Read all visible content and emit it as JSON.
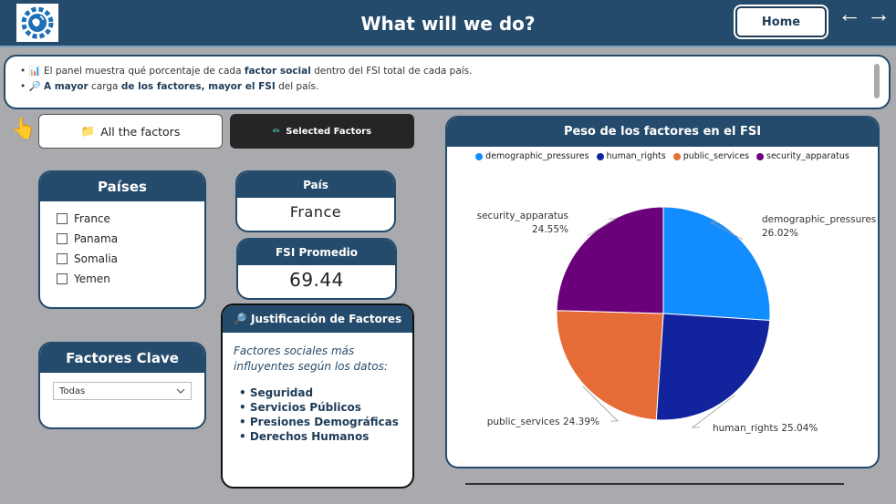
{
  "header": {
    "title": "What will we do?",
    "home_label": "Home",
    "back_arrow": "←",
    "forward_arrow": "→",
    "logo_icon": "gear-globe-icon"
  },
  "info": {
    "line1_prefix": "• 📊 El panel muestra qué porcentaje de cada ",
    "line1_bold": "factor social",
    "line1_suffix": " dentro del FSI total de cada país.",
    "line2_prefix": "• 🔎 ",
    "line2_bold1": "A mayor",
    "line2_mid1": " carga ",
    "line2_bold2": "de los factores, mayor el FSI",
    "line2_suffix": " del país."
  },
  "tabs": {
    "all_label": "All the factors",
    "all_icon": "📁",
    "selected_label": "Selected Factors",
    "selected_icon": "✏"
  },
  "paises": {
    "title": "Países",
    "items": [
      "France",
      "Panama",
      "Somalia",
      "Yemen"
    ]
  },
  "factores": {
    "title": "Factores Clave",
    "selected": "Todas"
  },
  "pais_card": {
    "title": "País",
    "value": "France"
  },
  "fsi_card": {
    "title": "FSI Promedio",
    "value": "69.44"
  },
  "justificacion": {
    "title": "Justificación de Factores",
    "intro": "Factores sociales más influyentes según los datos:",
    "items": [
      "Seguridad",
      "Servicios Públicos",
      "Presiones Demográficas",
      "Derechos Humanos"
    ]
  },
  "chart_data": {
    "type": "pie",
    "title": "Peso de los factores en el FSI",
    "legend_position": "top",
    "series": [
      {
        "name": "demographic_pressures",
        "value": 26.02,
        "label": "26.02%",
        "color": "#118dff"
      },
      {
        "name": "human_rights",
        "value": 25.04,
        "label": "25.04%",
        "color": "#12239e"
      },
      {
        "name": "public_services",
        "value": 24.39,
        "label": "24.39%",
        "color": "#e66c37"
      },
      {
        "name": "security_apparatus",
        "value": 24.55,
        "label": "24.55%",
        "color": "#6b007b"
      }
    ]
  }
}
